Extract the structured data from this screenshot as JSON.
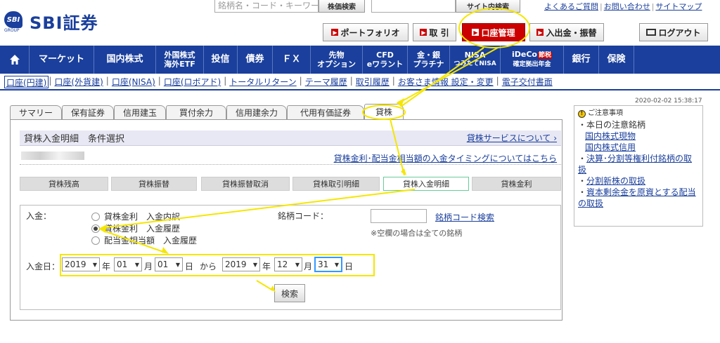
{
  "header": {
    "logo_badge": "SBI",
    "logo_group": "GROUP",
    "logo_text": "SBI証券",
    "search_placeholder": "銘柄名・コード・キーワード",
    "stock_search_btn": "株価検索",
    "site_search_btn": "サイト内検索",
    "top_links": [
      "よくあるご質問",
      "お問い合わせ",
      "サイトマップ"
    ],
    "buttons": {
      "portfolio": "ポートフォリオ",
      "trade": "取 引",
      "account": "口座管理",
      "deposit": "入出金・振替",
      "logout": "ログアウト"
    }
  },
  "nav": {
    "items": [
      {
        "label": "マーケット"
      },
      {
        "label": "国内株式"
      },
      {
        "label1": "外国株式",
        "label2": "海外ETF"
      },
      {
        "label": "投信"
      },
      {
        "label": "債券"
      },
      {
        "label": "ＦＸ"
      },
      {
        "label1": "先物",
        "label2": "オプション"
      },
      {
        "label1": "CFD",
        "label2": "eワラント"
      },
      {
        "label1": "金・銀",
        "label2": "プラチナ"
      },
      {
        "label1": "NISA",
        "label2": "つみたてNISA"
      },
      {
        "label1": "iDeCo",
        "badge": "節税",
        "label2": "確定拠出年金"
      },
      {
        "label": "銀行"
      },
      {
        "label": "保険"
      }
    ]
  },
  "subnav": [
    "口座(円建)",
    "口座(外貨建)",
    "口座(NISA)",
    "口座(ロボアド)",
    "トータルリターン",
    "テーマ履歴",
    "取引履歴",
    "お客さま情報 設定・変更",
    "電子交付書面"
  ],
  "timestamp": "2020-02-02 15:38:17",
  "tabs": [
    "サマリー",
    "保有証券",
    "信用建玉",
    "買付余力",
    "信用建余力",
    "代用有価証券",
    "貸株"
  ],
  "section": {
    "title": "貸株入金明細　条件選択",
    "service_link": "貸株サービスについて",
    "timing_link": "貸株金利･配当金相当額の入金タイミングについてはこちら"
  },
  "subtabs": [
    "貸株残高",
    "貸株振替",
    "貸株振替取消",
    "貸株取引明細",
    "貸株入金明細",
    "貸株金利"
  ],
  "form": {
    "deposit_label": "入金：",
    "radios": [
      "貸株金利　入金内訳",
      "貸株金利　入金履歴",
      "配当金相当額　入金履歴"
    ],
    "code_label": "銘柄コード：",
    "code_search_link": "銘柄コード検索",
    "code_note": "※空欄の場合は全ての銘柄",
    "date_label": "入金日：",
    "from": {
      "year": "2019",
      "month": "01",
      "day": "01"
    },
    "to": {
      "year": "2019",
      "month": "12",
      "day": "31"
    },
    "unit_year": "年",
    "unit_month": "月",
    "unit_day": "日",
    "kara": "から",
    "submit": "検索"
  },
  "notice": {
    "title": "ご注意事項",
    "items": [
      "本日の注意銘柄",
      "国内株式現物",
      "国内株式信用",
      "決算･分割等権利付銘柄の取扱",
      "分割新株の取扱",
      "資本剰余金を原資とする配当の取扱"
    ]
  },
  "colors": {
    "brand": "#1a3f9c",
    "accent": "#cc0000",
    "annotation": "#f5e600"
  }
}
